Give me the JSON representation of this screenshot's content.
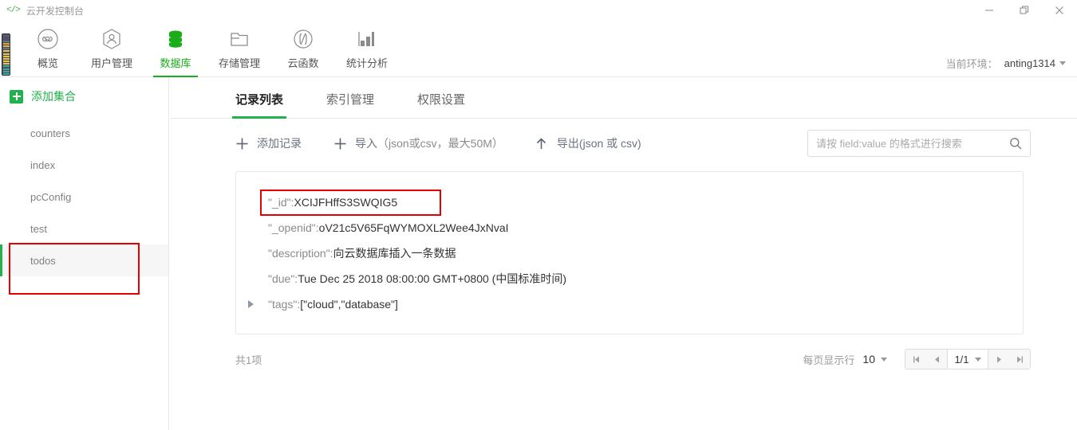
{
  "window": {
    "logo_icon": "code-brackets-icon",
    "title": "云开发控制台",
    "controls": [
      {
        "name": "minimize-button",
        "icon": "minimize-icon"
      },
      {
        "name": "maximize-button",
        "icon": "restore-icon"
      },
      {
        "name": "close-button",
        "icon": "close-icon"
      }
    ]
  },
  "topnav": {
    "items": [
      {
        "label": "概览",
        "icon": "infinity-icon",
        "active": false
      },
      {
        "label": "用户管理",
        "icon": "user-hexagon-icon",
        "active": false
      },
      {
        "label": "数据库",
        "icon": "database-icon",
        "active": true
      },
      {
        "label": "存储管理",
        "icon": "folder-icon",
        "active": false
      },
      {
        "label": "云函数",
        "icon": "cloud-function-icon",
        "active": false
      },
      {
        "label": "统计分析",
        "icon": "bar-chart-icon",
        "active": false
      }
    ],
    "env_label": "当前环境：",
    "env_value": "anting1314",
    "env_caret_icon": "chevron-down-icon",
    "accent_color": "#1aad19"
  },
  "sidebar": {
    "add_collection_label": "添加集合",
    "add_icon": "plus-square-icon",
    "collections": [
      {
        "name": "counters",
        "selected": false
      },
      {
        "name": "index",
        "selected": false
      },
      {
        "name": "pcConfig",
        "selected": false
      },
      {
        "name": "test",
        "selected": false
      },
      {
        "name": "todos",
        "selected": true
      }
    ]
  },
  "main": {
    "tabs": [
      {
        "label": "记录列表",
        "active": true
      },
      {
        "label": "索引管理",
        "active": false
      },
      {
        "label": "权限设置",
        "active": false
      }
    ],
    "toolbar": {
      "add_record_label": "添加记录",
      "add_record_icon": "plus-icon",
      "import_label": "导入",
      "import_icon": "plus-icon",
      "import_hint": "（json或csv，最大50M）",
      "export_label": "导出(json 或 csv)",
      "export_icon": "upload-icon"
    },
    "search": {
      "placeholder": "请按 field:value 的格式进行搜索",
      "value": "",
      "icon": "search-icon"
    },
    "record": {
      "expand_icon": "triangle-right-icon",
      "fields": [
        {
          "key": "\"_id\":",
          "value": "XCIJFHffS3SWQIG5",
          "expandable": false,
          "highlighted": true
        },
        {
          "key": "\"_openid\":",
          "value": "oV21c5V65FqWYMOXL2Wee4JxNvaI",
          "expandable": false,
          "highlighted": false
        },
        {
          "key": "\"description\":",
          "value": "向云数据库插入一条数据",
          "expandable": false,
          "highlighted": false
        },
        {
          "key": "\"due\":",
          "value": "Tue Dec 25 2018 08:00:00 GMT+0800 (中国标准时间)",
          "expandable": false,
          "highlighted": false
        },
        {
          "key": "\"tags\":",
          "value": "[\"cloud\",\"database\"]",
          "expandable": true,
          "highlighted": false
        }
      ]
    },
    "footer": {
      "total_text": "共1项",
      "page_size_label": "每页显示行",
      "page_size_value": "10",
      "page_size_caret_icon": "chevron-down-icon",
      "first_icon": "first-page-icon",
      "prev_icon": "prev-page-icon",
      "current_page": "1/1",
      "current_caret_icon": "chevron-down-icon",
      "next_icon": "next-page-icon",
      "last_icon": "last-page-icon"
    }
  },
  "annotations": {
    "highlight_color": "#e60000",
    "boxes": [
      "id-field-highlight",
      "todos-collection-highlight"
    ]
  }
}
